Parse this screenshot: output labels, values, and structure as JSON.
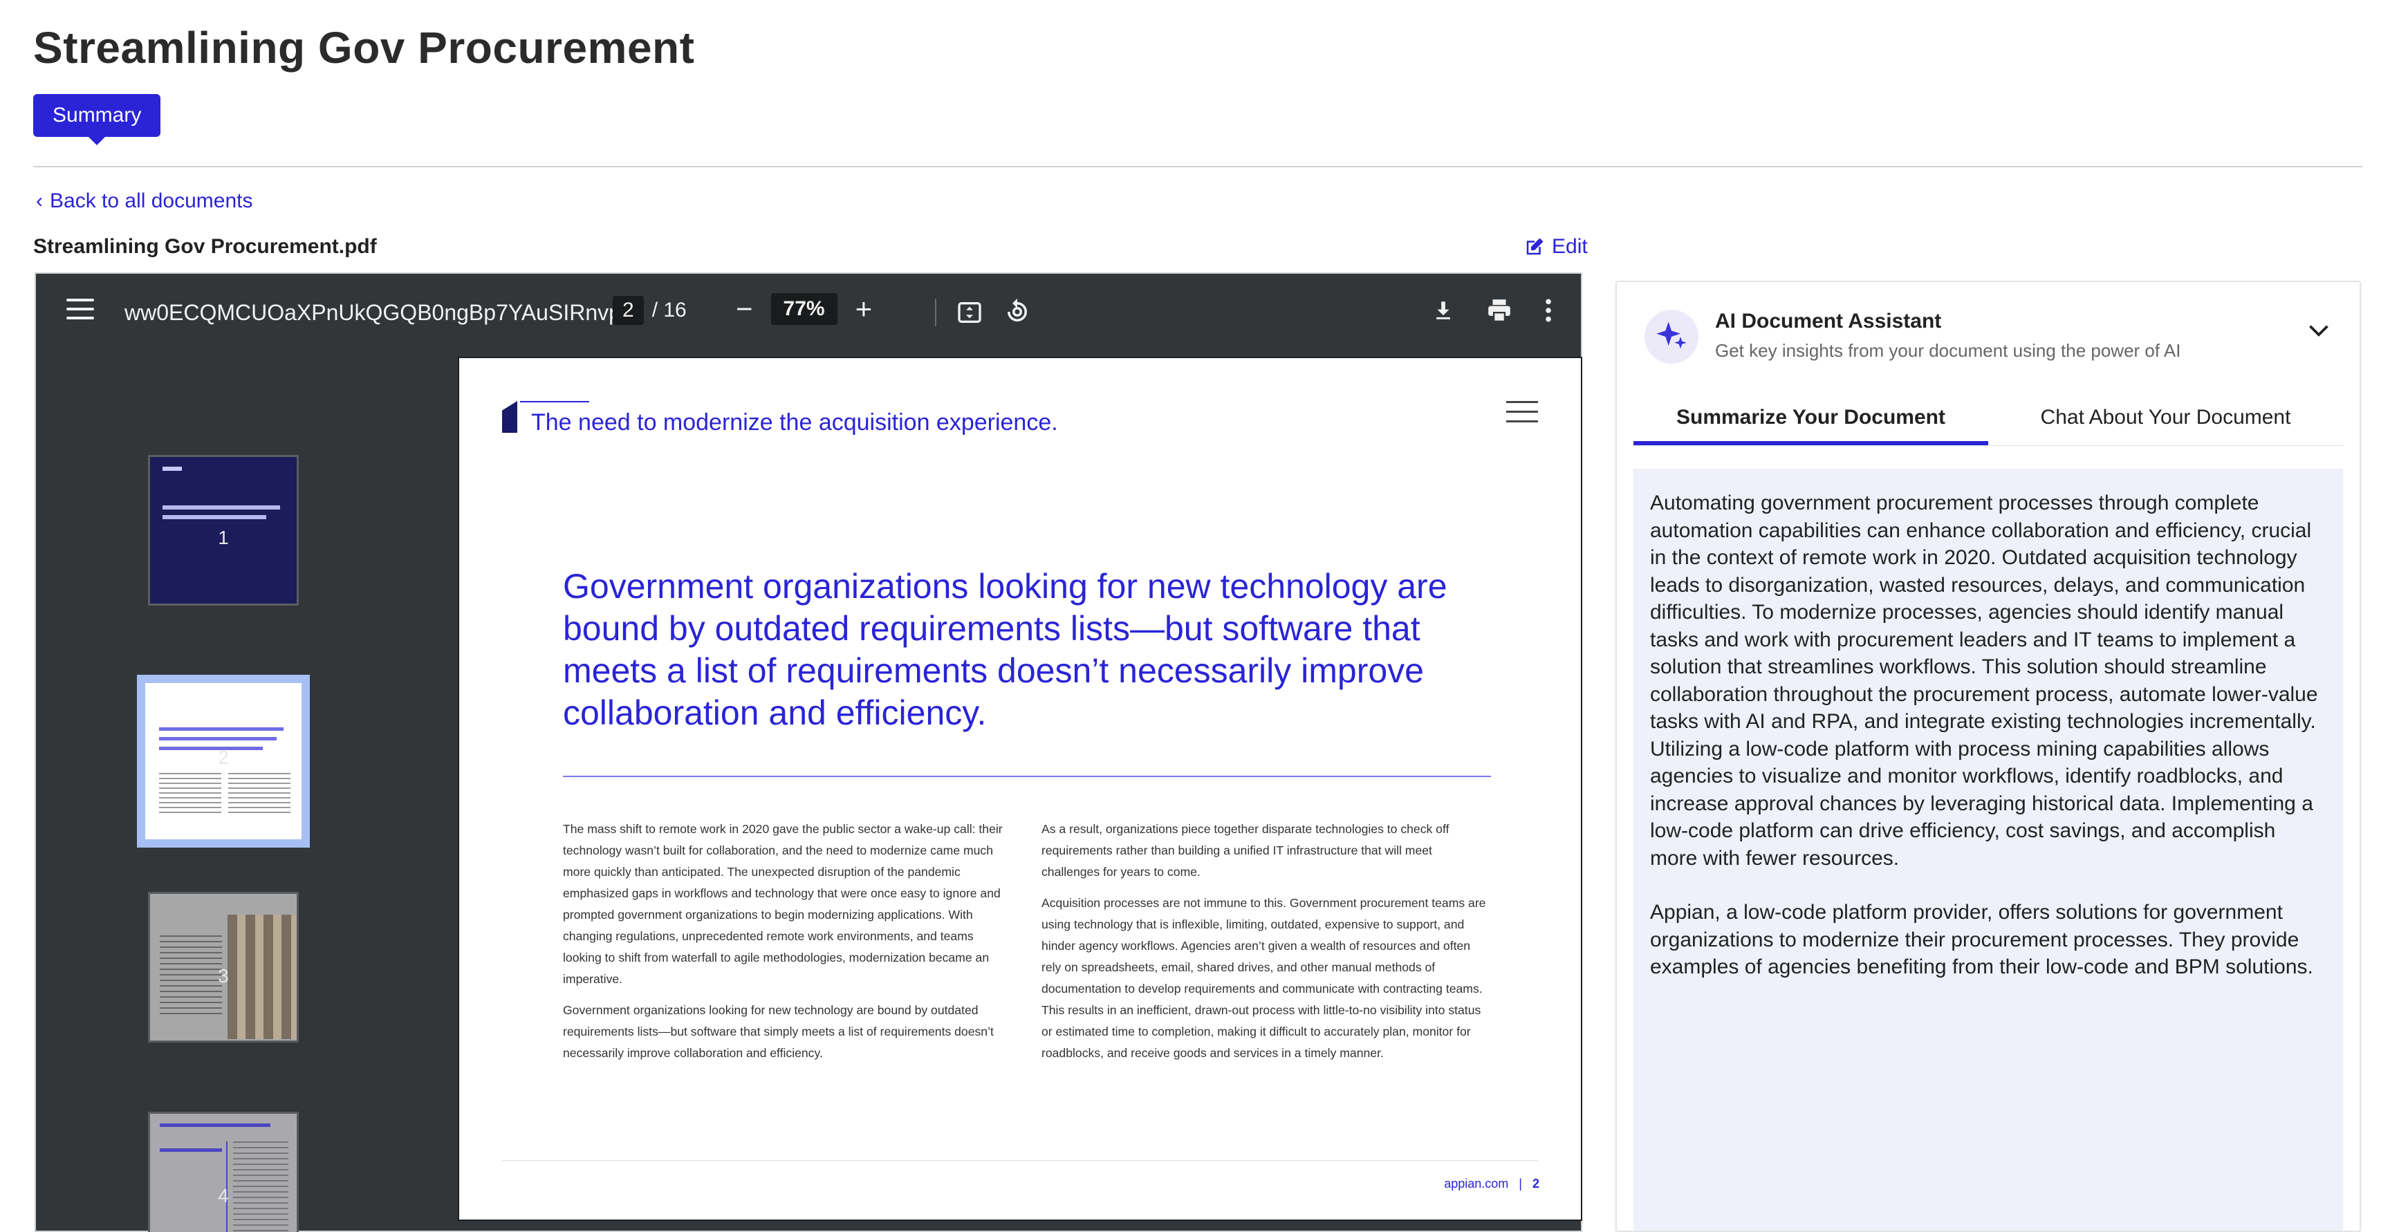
{
  "page": {
    "title": "Streamlining Gov Procurement",
    "summary_tab": "Summary",
    "back_link": "Back to all documents",
    "file_name": "Streamlining Gov Procurement.pdf",
    "edit_label": "Edit"
  },
  "viewer": {
    "doc_title": "ww0ECQMCUOaXPnUkQGQB0ngBp7YAuSIRnvp...",
    "current_page": "2",
    "page_total": "/ 16",
    "zoom": "77%",
    "zoom_out": "−",
    "zoom_in": "+",
    "thumbnails": [
      {
        "label": "1"
      },
      {
        "label": "2"
      },
      {
        "label": "3"
      },
      {
        "label": "4"
      }
    ],
    "selected_thumbnail": 2
  },
  "sheet": {
    "header": "The need to modernize the acquisition experience.",
    "headline": "Government organizations looking for new technology are bound by outdated requirements lists—but software that meets a list of requirements doesn’t necessarily improve collaboration and efficiency.",
    "col1_p1": "The mass shift to remote work in 2020 gave the public sector a wake-up call: their technology wasn’t built for collaboration, and the need to modernize came much more quickly than anticipated. The unexpected disruption of the pandemic emphasized gaps in workflows and technology that were once easy to ignore and prompted government organizations to begin modernizing applications. With changing regulations, unprecedented remote work environments, and teams looking to shift from waterfall to agile methodologies, modernization became an imperative.",
    "col1_p2": "Government organizations looking for new technology are bound by outdated requirements lists—but software that simply meets a list of requirements doesn’t necessarily improve collaboration and efficiency.",
    "col2_p1": "As a result, organizations piece together disparate technologies to check off requirements rather than building a unified IT infrastructure that will meet challenges for years to come.",
    "col2_p2": "Acquisition processes are not immune to this. Government procurement teams are using technology that is inflexible, limiting, outdated, expensive to support, and hinder agency workflows. Agencies aren’t given a wealth of resources and often rely on spreadsheets, email, shared drives, and other manual methods of documentation to develop requirements and communicate with contracting teams. This results in an inefficient, drawn-out process with little-to-no visibility into status or estimated time to completion, making it difficult to accurately plan, monitor for roadblocks, and receive goods and services in a timely manner.",
    "footer_site": "appian.com",
    "footer_sep": "|",
    "footer_page": "2"
  },
  "assistant": {
    "title": "AI Document Assistant",
    "subtitle": "Get key insights from your document using the power of AI",
    "tabs": [
      {
        "label": "Summarize Your Document",
        "active": true
      },
      {
        "label": "Chat About Your Document",
        "active": false
      }
    ],
    "summary_p1": "Automating government procurement processes through complete automation capabilities can enhance collaboration and efficiency, crucial in the context of remote work in 2020. Outdated acquisition technology leads to disorganization, wasted resources, delays, and communication difficulties. To modernize processes, agencies should identify manual tasks and work with procurement leaders and IT teams to implement a solution that streamlines workflows. This solution should streamline collaboration throughout the procurement process, automate lower-value tasks with AI and RPA, and integrate existing technologies incrementally. Utilizing a low-code platform with process mining capabilities allows agencies to visualize and monitor workflows, identify roadblocks, and increase approval chances by leveraging historical data. Implementing a low-code platform can drive efficiency, cost savings, and accomplish more with fewer resources.",
    "summary_p2": "Appian, a low-code platform provider, offers solutions for government organizations to modernize their procurement processes. They provide examples of agencies benefiting from their low-code and BPM solutions."
  },
  "colors": {
    "accent": "#2a24d6",
    "toolbar_bg": "#323639",
    "summary_bg": "#eef0fa"
  },
  "icons": [
    "menu-icon",
    "fit-page-icon",
    "rotate-icon",
    "download-icon",
    "print-icon",
    "more-vert-icon",
    "edit-icon",
    "sparkle-icon",
    "chevron-down-icon",
    "chevron-left-icon"
  ]
}
